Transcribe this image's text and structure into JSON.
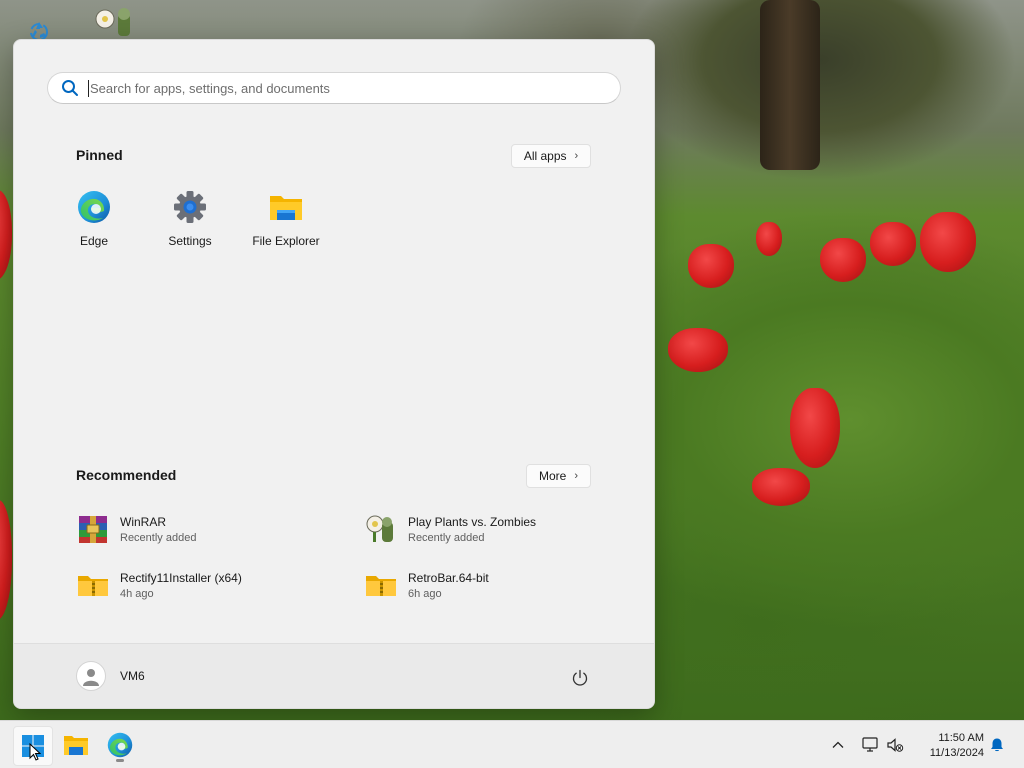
{
  "desktop": {
    "icons": [
      {
        "name": "recycle-bin-icon"
      },
      {
        "name": "plants-vs-zombies-icon"
      }
    ]
  },
  "start_menu": {
    "search": {
      "placeholder": "Search for apps, settings, and documents",
      "value": ""
    },
    "pinned": {
      "title": "Pinned",
      "all_apps_label": "All apps",
      "apps": [
        {
          "label": "Edge",
          "icon": "edge-icon"
        },
        {
          "label": "Settings",
          "icon": "gear-icon"
        },
        {
          "label": "File Explorer",
          "icon": "folder-icon"
        }
      ]
    },
    "recommended": {
      "title": "Recommended",
      "more_label": "More",
      "items": [
        {
          "name": "WinRAR",
          "sub": "Recently added",
          "icon": "winrar-icon"
        },
        {
          "name": "Play Plants vs. Zombies",
          "sub": "Recently added",
          "icon": "plants-vs-zombies-icon"
        },
        {
          "name": "Rectify11Installer (x64)",
          "sub": "4h ago",
          "icon": "zip-folder-icon"
        },
        {
          "name": "RetroBar.64-bit",
          "sub": "6h ago",
          "icon": "zip-folder-icon"
        }
      ]
    },
    "footer": {
      "user_name": "VM6",
      "power_icon": "power-icon"
    }
  },
  "taskbar": {
    "apps": [
      {
        "name": "start-button",
        "icon": "windows-logo-icon",
        "active": true
      },
      {
        "name": "file-explorer-taskbar",
        "icon": "folder-icon",
        "active": false
      },
      {
        "name": "edge-taskbar",
        "icon": "edge-icon",
        "active": false,
        "running": true
      }
    ],
    "tray": {
      "chevron_icon": "chevron-up-icon",
      "network_icon": "network-disconnected-icon",
      "volume_icon": "volume-muted-icon",
      "notification_icon": "bell-icon"
    },
    "clock": {
      "time": "11:50 AM",
      "date": "11/13/2024"
    }
  },
  "colors": {
    "accent": "#0067c0",
    "menu_bg": "#f1f1f1",
    "taskbar_bg": "#eeeeee"
  }
}
